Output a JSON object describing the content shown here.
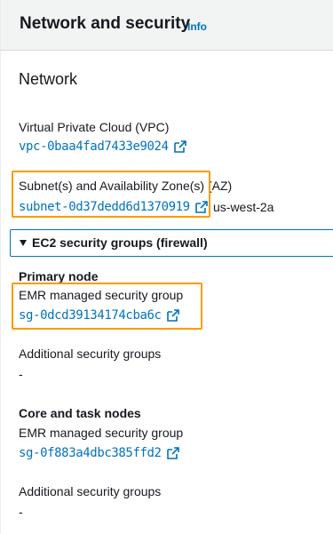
{
  "header": {
    "title": "Network and security",
    "info_link": "Info"
  },
  "network": {
    "section_title": "Network",
    "vpc_label": "Virtual Private Cloud (VPC)",
    "vpc_value": "vpc-0baa4fad7433e9024",
    "subnet_label": "Subnet(s) and Availability Zone(s) (AZ)",
    "subnet_value": "subnet-0d37dedd6d1370919",
    "az_value": "us-west-2a"
  },
  "security_groups": {
    "expander_label": "EC2 security groups (firewall)",
    "primary_node": {
      "heading": "Primary node",
      "emr_label": "EMR managed security group",
      "emr_value": "sg-0dcd39134174cba6c",
      "additional_label": "Additional security groups",
      "additional_value": "-"
    },
    "core_task_nodes": {
      "heading": "Core and task nodes",
      "emr_label": "EMR managed security group",
      "emr_value": "sg-0f883a4dbc385ffd2",
      "additional_label": "Additional security groups",
      "additional_value": "-"
    }
  },
  "colors": {
    "link": "#0073bb",
    "highlight": "#ff9900",
    "text": "#16191f"
  },
  "icons": {
    "external_link": "external-link-icon",
    "caret": "caret-down-icon"
  }
}
